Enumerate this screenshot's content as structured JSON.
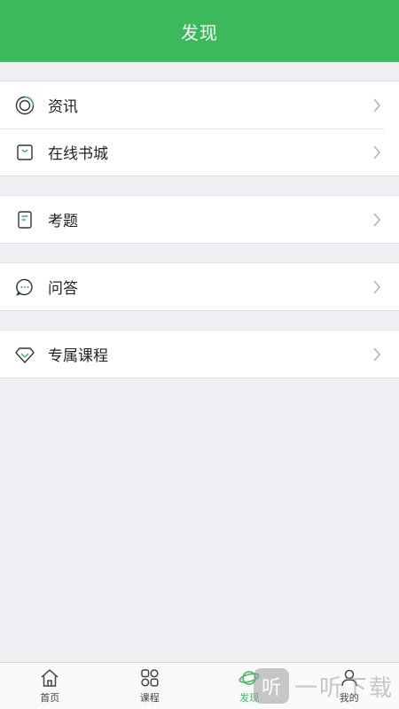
{
  "header": {
    "title": "发现"
  },
  "groups": [
    {
      "items": [
        {
          "label": "资讯",
          "icon": "news-icon"
        },
        {
          "label": "在线书城",
          "icon": "shopping-bag-icon"
        }
      ]
    },
    {
      "items": [
        {
          "label": "考题",
          "icon": "exam-paper-icon"
        }
      ]
    },
    {
      "items": [
        {
          "label": "问答",
          "icon": "chat-bubble-icon"
        }
      ]
    },
    {
      "items": [
        {
          "label": "专属课程",
          "icon": "diamond-icon"
        }
      ]
    }
  ],
  "tabbar": {
    "items": [
      {
        "label": "首页",
        "icon": "home-icon"
      },
      {
        "label": "课程",
        "icon": "grid-icon"
      },
      {
        "label": "发现",
        "icon": "planet-icon",
        "active": true
      },
      {
        "label": "我的",
        "icon": "user-icon"
      }
    ]
  },
  "watermark": {
    "badge": "听",
    "text": "一听下载"
  },
  "colors": {
    "accent": "#3cb95a",
    "background": "#efeff4"
  }
}
